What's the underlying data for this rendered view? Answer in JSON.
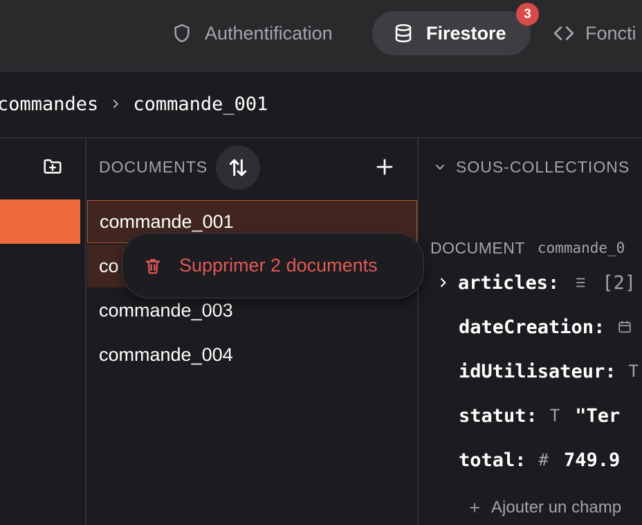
{
  "topbar": {
    "tabs": [
      {
        "label": "Authentification",
        "icon": "shield-icon",
        "active": false
      },
      {
        "label": "Firestore",
        "icon": "database-icon",
        "active": true
      },
      {
        "label": "Foncti",
        "icon": "code-icon",
        "active": false
      }
    ],
    "firestore_badge": "3"
  },
  "breadcrumb": {
    "collection": "commandes",
    "document": "commande_001"
  },
  "documents_panel": {
    "header": "DOCUMENTS",
    "rows": [
      "commande_001",
      "co",
      "commande_003",
      "commande_004"
    ]
  },
  "context_menu": {
    "label": "Supprimer 2 documents"
  },
  "right_panel": {
    "subcollections_header": "SOUS-COLLECTIONS",
    "document_label": "DOCUMENT",
    "document_id": "commande_0",
    "fields": [
      {
        "name": "articles:",
        "type_icon": "list-icon",
        "value": "[2]"
      },
      {
        "name": "dateCreation:",
        "type_icon": "calendar-icon",
        "value": ""
      },
      {
        "name": "idUtilisateur:",
        "type_icon": "text-type-icon",
        "value": ""
      },
      {
        "name": "statut:",
        "type_icon": "text-type-icon",
        "value": "\"Ter"
      },
      {
        "name": "total:",
        "type_icon": "number-icon",
        "value": "749.9"
      }
    ],
    "add_field_label": "Ajouter un champ"
  },
  "colors": {
    "accent": "#ee6a3c",
    "danger": "#e05a57",
    "background": "#1c1b1f",
    "selected_row": "#41261f"
  }
}
